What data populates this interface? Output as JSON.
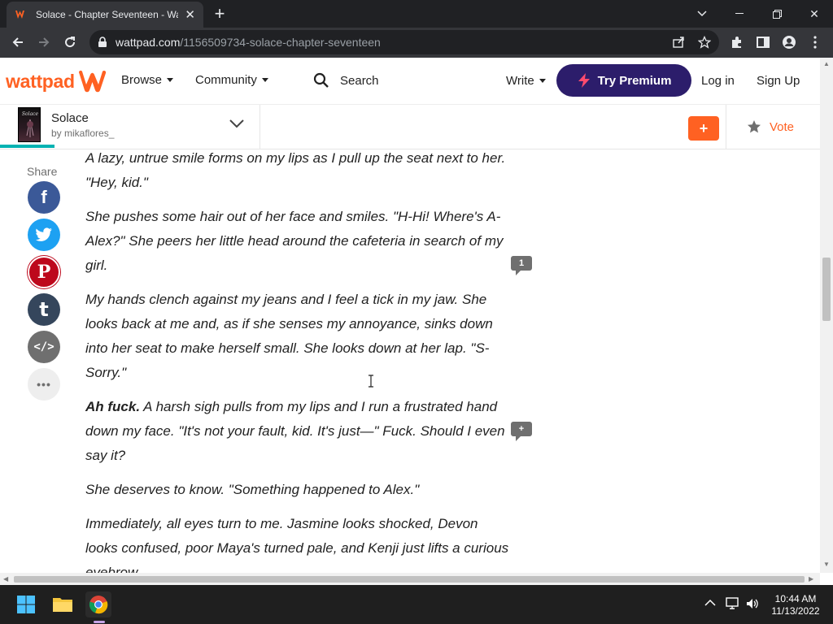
{
  "browser": {
    "tab_title": "Solace - Chapter Seventeen - Wa",
    "url_host": "wattpad.com",
    "url_path": "/1156509734-solace-chapter-seventeen"
  },
  "header": {
    "logo_text": "wattpad",
    "browse": "Browse",
    "community": "Community",
    "search": "Search",
    "write": "Write",
    "premium": "Try Premium",
    "login": "Log in",
    "signup": "Sign Up"
  },
  "story": {
    "title": "Solace",
    "author": "by mikaflores_",
    "add_label": "+",
    "vote_label": "Vote"
  },
  "share": {
    "label": "Share",
    "buttons": [
      {
        "name": "facebook",
        "glyph": "f",
        "color": "#3b5998"
      },
      {
        "name": "twitter",
        "glyph": "",
        "color": "#1da1f2"
      },
      {
        "name": "pinterest",
        "glyph": "P",
        "color": "#bd081c"
      },
      {
        "name": "tumblr",
        "glyph": "t",
        "color": "#35465c"
      },
      {
        "name": "embed",
        "glyph": "</>",
        "color": "#6f6f6f"
      },
      {
        "name": "more",
        "glyph": "•••",
        "color": "#eeeeee"
      }
    ]
  },
  "paragraphs": [
    {
      "text": "A lazy, untrue smile forms on my lips as I pull up the seat next to her. \"Hey, kid.\""
    },
    {
      "text": "She pushes some hair out of her face and smiles. \"H-Hi! Where's A-Alex?\" She peers her little head around the cafeteria in search of my girl.",
      "comments": "1"
    },
    {
      "text": "My hands clench against my jeans and I feel a tick in my jaw. She looks back at me and, as if she senses my annoyance, sinks down into her seat to make herself small. She looks down at her lap. \"S-Sorry.\""
    },
    {
      "bold": "Ah fuck.",
      "text": " A harsh sigh pulls from my lips and I run a frustrated hand down my face. \"It's not your fault, kid. It's just—\" Fuck. Should I even say it?",
      "comments": "+"
    },
    {
      "text": "She deserves to know. \"Something happened to Alex.\""
    },
    {
      "text": "Immediately, all eyes turn to me. Jasmine looks shocked, Devon looks confused, poor Maya's turned pale, and Kenji just lifts a curious eyebrow."
    }
  ],
  "taskbar": {
    "time": "10:44 AM",
    "date": "11/13/2022"
  },
  "colors": {
    "brand_orange": "#ff6122",
    "premium_purple": "#2c1d6b",
    "progress_teal": "#00b2b2"
  }
}
